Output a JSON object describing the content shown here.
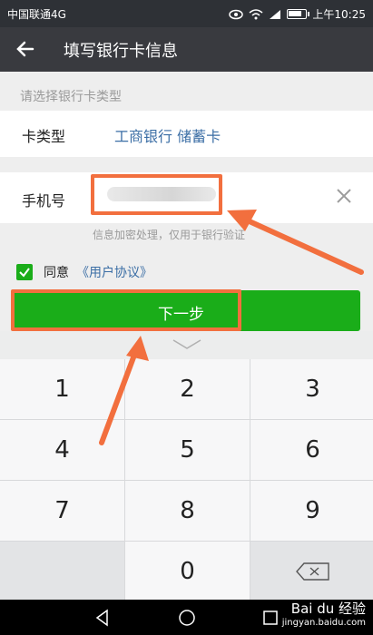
{
  "status_bar": {
    "carrier": "中国联通4G",
    "time": "上午10:25",
    "battery_level_pct": 80
  },
  "app_bar": {
    "back_icon": "arrow-left-icon",
    "title": "填写银行卡信息"
  },
  "form": {
    "section_hint": "请选择银行卡类型",
    "card_type": {
      "label": "卡类型",
      "value": "工商银行 储蓄卡"
    },
    "phone": {
      "label": "手机号",
      "value": "",
      "clear_icon": "close-icon"
    },
    "encrypt_hint": "信息加密处理，仅用于银行验证",
    "agreement": {
      "checked": true,
      "text": "同意",
      "link": "《用户协议》"
    },
    "next_button": "下一步"
  },
  "keyboard": {
    "collapse_icon": "chevron-down-icon",
    "keys": [
      "1",
      "2",
      "3",
      "4",
      "5",
      "6",
      "7",
      "8",
      "9",
      "",
      "0",
      ""
    ],
    "delete_icon": "backspace-icon"
  },
  "nav_bar": {
    "back_icon": "triangle-back-icon",
    "home_icon": "circle-home-icon",
    "recent_icon": "square-recent-icon"
  },
  "watermark": {
    "brand": "Bai du 经验",
    "url": "jingyan.baidu.com"
  },
  "colors": {
    "accent_green": "#1aad19",
    "annotation_orange": "#f26f3e",
    "link_blue": "#3b6ea5",
    "appbar": "#393a3f"
  }
}
